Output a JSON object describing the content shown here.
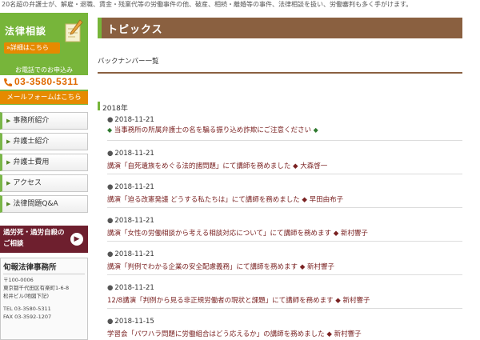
{
  "top_note": "20名超の弁護士が、解雇・退職、賃金・残業代等の労働事件の他、破産、相続・離婚等の事件、法律相談を扱い、労働審判も多く手がけます。",
  "sidebar": {
    "consult_title": "法律相談",
    "detail_link": "»詳細はこちら",
    "phone_label": "お電話でのお申込み",
    "phone_number": "03-3580-5311",
    "mail_link": "メールフォームはこちら",
    "nav_items": [
      {
        "label": "事務所紹介"
      },
      {
        "label": "弁護士紹介"
      },
      {
        "label": "弁護士費用"
      },
      {
        "label": "アクセス"
      },
      {
        "label": "法律問題Q&A"
      }
    ],
    "promo_line1": "過労死・過労自殺の",
    "promo_line2": "ご相談",
    "promo_arrow": "▶",
    "office": {
      "name": "旬報法律事務所",
      "postal": "〒100-0006",
      "address1": "東京都千代田区有楽町1-6-8",
      "address2": "松井ビル(地図下記)",
      "tel": "TEL 03-3580-5311",
      "fax": "FAX 03-3592-1207"
    }
  },
  "main": {
    "topics_title": "トピックス",
    "backnumber": "バックナンバー一覧",
    "year": "2018年",
    "entries": [
      {
        "date": "2018-11-21",
        "title": "当事務所の所属弁護士の名を騙る振り込め詐欺にご注意ください"
      },
      {
        "date": "2018-11-21",
        "title": "講演「自死遺族をめぐる法的諸問題」にて講師を務めました ◆ 大森啓一"
      },
      {
        "date": "2018-11-21",
        "title": "講演「迫る改憲発議 どうする私たちは」にて講師を務めました ◆ 早田由布子"
      },
      {
        "date": "2018-11-21",
        "title": "講演「女性の労働相談から考える相談対応について」にて講師を務めます ◆ 新村響子"
      },
      {
        "date": "2018-11-21",
        "title": "講演「判例でわかる企業の安全配慮義務」にて講師を務めます ◆ 新村響子"
      },
      {
        "date": "2018-11-21",
        "title": "12/8講演「判例から見る非正規労働者の現状と課題」にて講師を務めます ◆ 新村響子"
      },
      {
        "date": "2018-11-15",
        "title": "学習会「パワハラ問題に労働組合はどう応えるか」の講師を務めました ◆ 新村響子"
      }
    ]
  }
}
